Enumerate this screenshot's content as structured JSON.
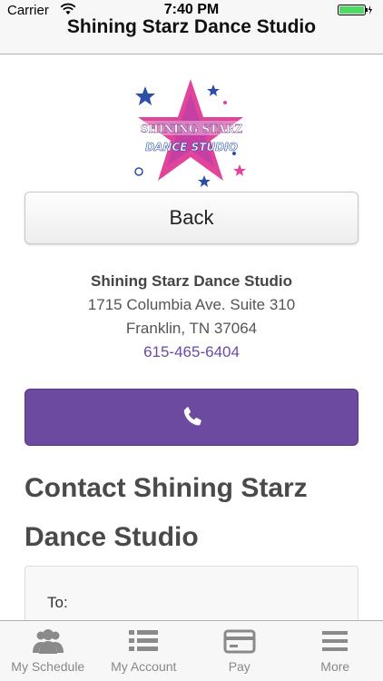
{
  "status_bar": {
    "carrier": "Carrier",
    "time": "7:40 PM"
  },
  "nav": {
    "title": "Shining Starz Dance Studio"
  },
  "logo": {
    "line1": "SHINING STARZ",
    "line2": "DANCE STUDIO"
  },
  "back_label": "Back",
  "studio": {
    "name": "Shining Starz Dance Studio",
    "address": "1715 Columbia Ave. Suite 310",
    "city": "Franklin, TN 37064",
    "phone": "615-465-6404"
  },
  "contact": {
    "heading": "Contact Shining Starz Dance Studio",
    "to_label": "To:"
  },
  "tabs": [
    {
      "label": "My Schedule",
      "icon": "users-icon"
    },
    {
      "label": "My Account",
      "icon": "list-icon"
    },
    {
      "label": "Pay",
      "icon": "credit-card-icon"
    },
    {
      "label": "More",
      "icon": "menu-icon"
    }
  ],
  "colors": {
    "accent": "#6b4a9f",
    "phone_link": "#6a4aa5",
    "logo_pink": "#e0459b",
    "logo_blue": "#2c4ea8"
  }
}
